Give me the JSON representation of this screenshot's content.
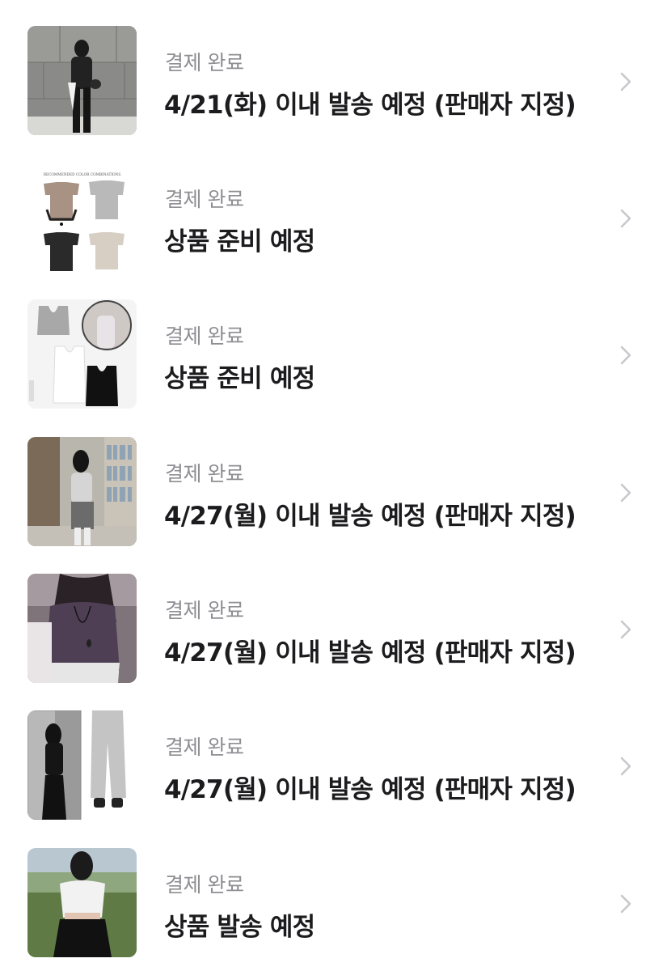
{
  "orders": [
    {
      "status": "결제 완료",
      "detail": "4/21(화) 이내 발송 예정 (판매자 지정)",
      "image": "product-photo-woman-black-outfit"
    },
    {
      "status": "결제 완료",
      "detail": "상품 준비 예정",
      "image": "product-photo-four-long-sleeve-tops",
      "image_text": [
        "RECOMMENDED COLOR COMBINATIONS"
      ]
    },
    {
      "status": "결제 완료",
      "detail": "상품 준비 예정",
      "image": "product-photo-tank-tops"
    },
    {
      "status": "결제 완료",
      "detail": "4/27(월) 이내 발송 예정 (판매자 지정)",
      "image": "product-photo-bookstore-outfit"
    },
    {
      "status": "결제 완료",
      "detail": "4/27(월) 이내 발송 예정 (판매자 지정)",
      "image": "product-photo-purple-knit-top"
    },
    {
      "status": "결제 완료",
      "detail": "4/27(월) 이내 발송 예정 (판매자 지정)",
      "image": "product-photo-grey-sweatpants"
    },
    {
      "status": "결제 완료",
      "detail": "상품 발송 예정",
      "image": "product-photo-white-top-outdoor"
    }
  ],
  "icons": {
    "chevron": "chevron-right-icon"
  },
  "colors": {
    "status_text": "#8e8e93",
    "detail_text": "#1c1c1e",
    "chevron": "#c7c7cc"
  }
}
